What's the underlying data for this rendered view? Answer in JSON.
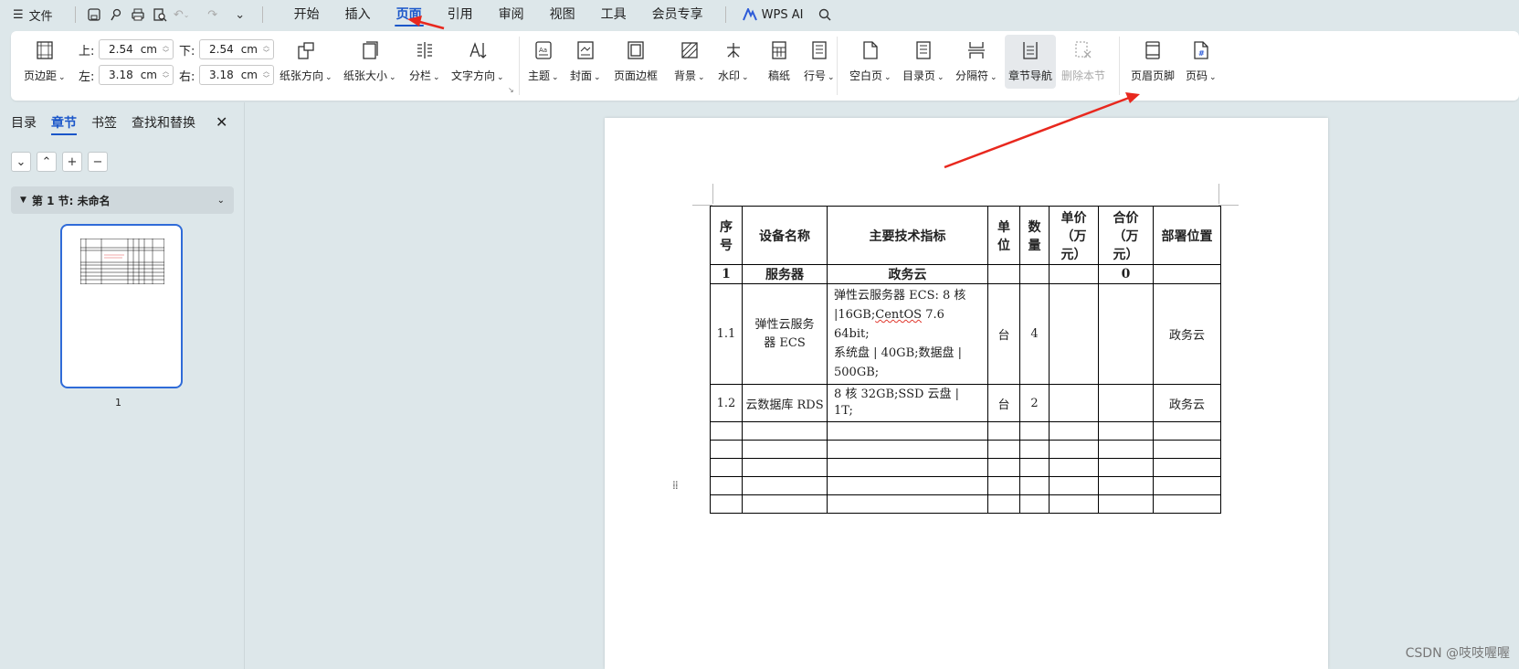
{
  "menubar": {
    "file_label": "文件",
    "tabs": [
      "开始",
      "插入",
      "页面",
      "引用",
      "审阅",
      "视图",
      "工具",
      "会员专享"
    ],
    "active_tab": "页面",
    "ai_label": "WPS AI"
  },
  "margins": {
    "top_label": "上:",
    "top_value": "2.54",
    "bottom_label": "下:",
    "bottom_value": "2.54",
    "left_label": "左:",
    "left_value": "3.18",
    "right_label": "右:",
    "right_value": "3.18",
    "unit": "cm",
    "button_label": "页边距"
  },
  "ribbon": {
    "orientation": "纸张方向",
    "size": "纸张大小",
    "columns": "分栏",
    "text_direction": "文字方向",
    "theme": "主题",
    "cover": "封面",
    "page_border": "页面边框",
    "background": "背景",
    "watermark": "水印",
    "manuscript": "稿纸",
    "line_number": "行号",
    "blank_page": "空白页",
    "toc_page": "目录页",
    "separator": "分隔符",
    "chapter_nav": "章节导航",
    "delete_section": "删除本节",
    "header_footer": "页眉页脚",
    "page_number": "页码"
  },
  "leftpane": {
    "tabs": [
      "目录",
      "章节",
      "书签",
      "查找和替换"
    ],
    "active_tab": "章节",
    "section_label": "第 1 节: 未命名",
    "page_number": "1"
  },
  "table": {
    "headers": [
      "序号",
      "设备名称",
      "主要技术指标",
      "单位",
      "数量",
      "单价（万元）",
      "合价（万元）",
      "部署位置"
    ],
    "header_display": [
      "序<br>号",
      "设备名称",
      "主要技术指标",
      "单<br>位",
      "数<br>量",
      "单价<br>（万<br>元）",
      "合价<br>（万<br>元）",
      "部署位置"
    ],
    "group_row": [
      "1",
      "服务器",
      "政务云",
      "",
      "",
      "",
      "0",
      ""
    ],
    "row1": {
      "no": "1.1",
      "name_line1": "弹性云服务",
      "name_line2": "器 ECS",
      "spec_line1": "弹性云服务器 ECS: 8 核",
      "spec_line2a": "|16GB;",
      "spec_line2b": "CentOS",
      "spec_line2c": " 7.6 64bit;",
      "spec_line3": "系统盘 | 40GB;数据盘 |",
      "spec_line4": "500GB;",
      "unit": "台",
      "qty": "4",
      "price": "",
      "total": "",
      "location": "政务云"
    },
    "row2": {
      "no": "1.2",
      "name": "云数据库 RDS",
      "spec": "8 核 32GB;SSD 云盘 | 1T;",
      "unit": "台",
      "qty": "2",
      "price": "",
      "total": "",
      "location": "政务云"
    },
    "empty_rows": 5
  },
  "watermark_text": "CSDN @吱吱喔喔",
  "colors": {
    "accent": "#1a56c9",
    "arrow": "#e8281e"
  }
}
